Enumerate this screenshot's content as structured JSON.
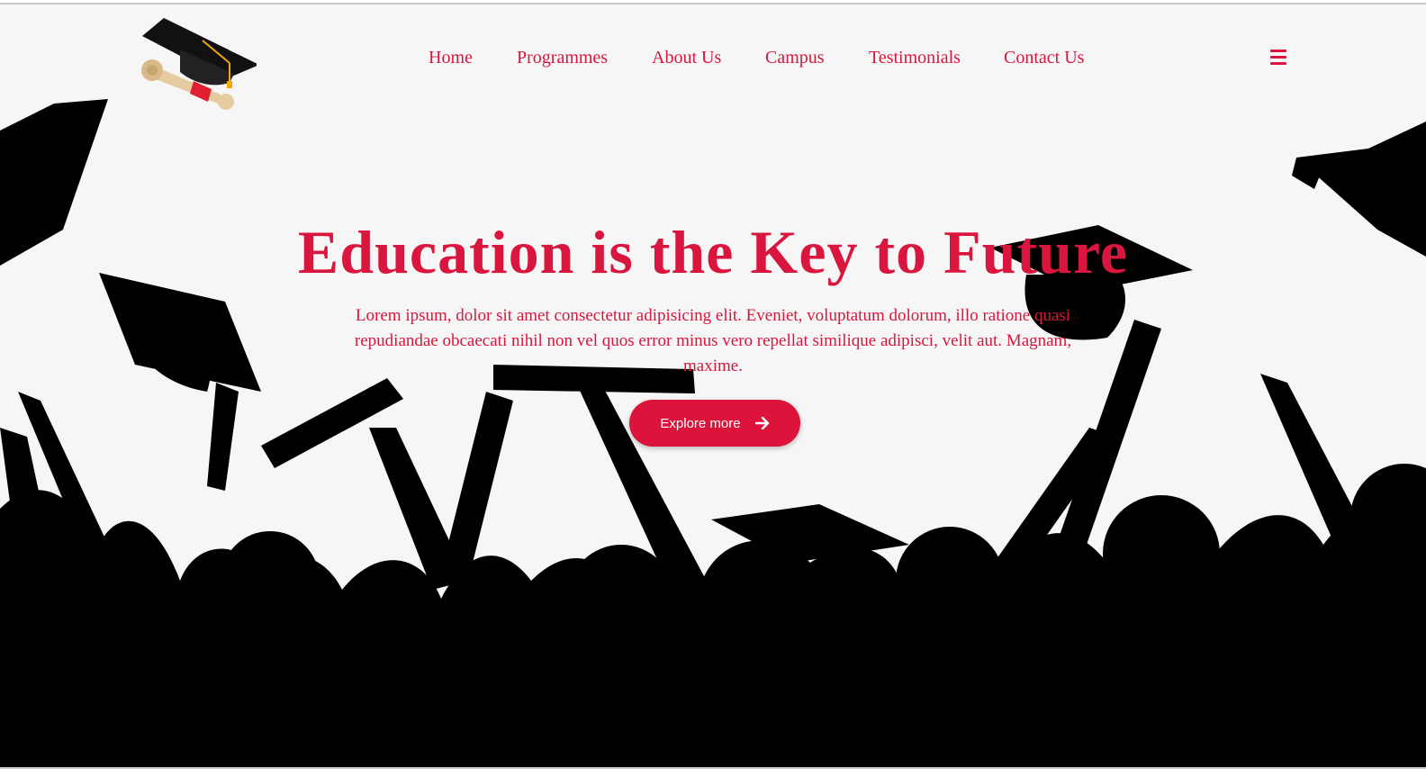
{
  "nav": {
    "items": [
      {
        "label": "Home"
      },
      {
        "label": "Programmes"
      },
      {
        "label": "About Us"
      },
      {
        "label": "Campus"
      },
      {
        "label": "Testimonials"
      },
      {
        "label": "Contact Us"
      }
    ],
    "menu_icon": "hamburger-menu-icon"
  },
  "logo": {
    "icon": "graduation-cap-diploma-icon"
  },
  "hero": {
    "title": "Education is the Key to Future",
    "text": "Lorem ipsum, dolor sit amet consectetur adipisicing elit. Eveniet, voluptatum dolorum, illo ratione quasi repudiandae obcaecati nihil non vel quos error minus vero repellat similique adipisci, velit aut. Magnam, maxime.",
    "cta_label": "Explore more",
    "cta_icon": "arrow-right-icon"
  },
  "colors": {
    "accent": "#dc143c",
    "background": "#f6f6f6",
    "silhouette": "#000000"
  }
}
